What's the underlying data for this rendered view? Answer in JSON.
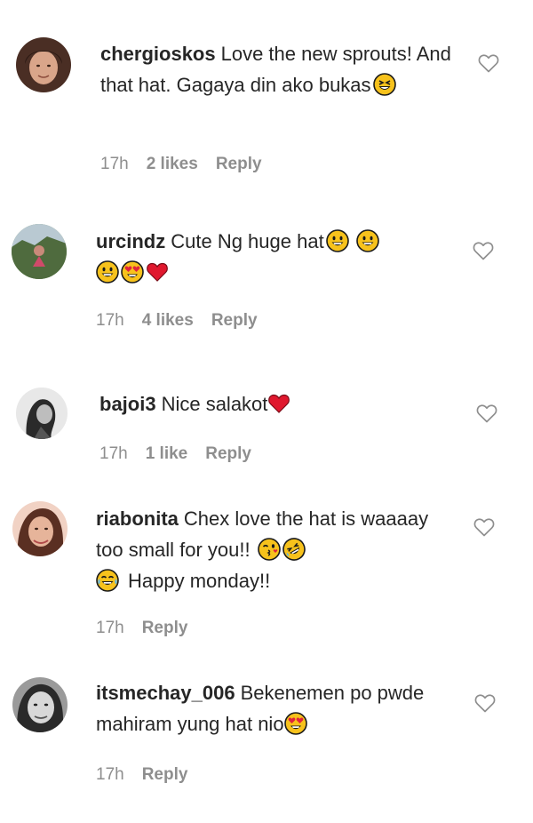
{
  "comments": [
    {
      "username": "chergioskos",
      "text": "Love the new sprouts! And that hat. Gagaya din ako bukas",
      "time": "17h",
      "likes": "2 likes",
      "reply": "Reply",
      "emoji": [
        "grinning-squinting-face"
      ]
    },
    {
      "username": "urcindz",
      "text": "Cute Ng huge hat",
      "time": "17h",
      "likes": "4 likes",
      "reply": "Reply",
      "emoji": [
        "grinning-face",
        "grinning-face",
        "grinning-face",
        "heart-eyes-face",
        "red-heart"
      ]
    },
    {
      "username": "bajoi3",
      "text": "Nice salakot",
      "time": "17h",
      "likes": "1 like",
      "reply": "Reply",
      "emoji": [
        "red-heart"
      ]
    },
    {
      "username": "riabonita",
      "text": "Chex love the hat is waaaay too small for you!!",
      "text2": "Happy monday!!",
      "time": "17h",
      "reply": "Reply",
      "emoji": [
        "winking-kiss-face",
        "rolling-laughing-face",
        "tears-of-joy-face"
      ]
    },
    {
      "username": "itsmechay_006",
      "text": "Bekenemen po pwde mahiram yung hat nio",
      "time": "17h",
      "reply": "Reply",
      "emoji": [
        "heart-eyes-face"
      ]
    }
  ]
}
